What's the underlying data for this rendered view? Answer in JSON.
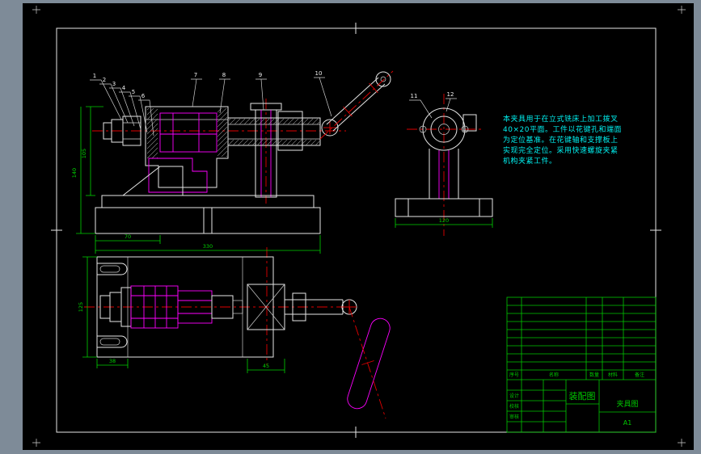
{
  "window": {
    "outer_bg": "#7e8b98",
    "canvas_bg": "#000000"
  },
  "palette": {
    "outline": "#e6e6e6",
    "dimension": "#00d200",
    "centerline": "#e00000",
    "phantom": "#ff00ff",
    "note": "#00f0f0",
    "titleblock": "#00c800"
  },
  "note": {
    "lines": [
      "本夹具用于在立式铣床上加工拨叉",
      "40×20平面。工件以花键孔和端面",
      "为定位基准。在花键轴和支撑板上",
      "实现完全定位。采用快速螺旋夹紧",
      "机构夹紧工件。"
    ]
  },
  "balloons": [
    {
      "label": "1"
    },
    {
      "label": "2"
    },
    {
      "label": "3"
    },
    {
      "label": "4"
    },
    {
      "label": "5"
    },
    {
      "label": "6"
    },
    {
      "label": "7"
    },
    {
      "label": "8"
    },
    {
      "label": "9"
    },
    {
      "label": "10"
    },
    {
      "label": "11"
    },
    {
      "label": "12"
    }
  ],
  "dimensions": {
    "front_height_upper": "105",
    "front_height_total": "140",
    "front_base_sub": "70",
    "front_base_width": "330",
    "side_base_width": "120",
    "top_plate_depth": "125",
    "top_slot": "38",
    "top_block": "45"
  },
  "title_block": {
    "drawing_title": "装配图",
    "drawing_name": "夹具图",
    "sheet_size": "A1",
    "parts_header": [
      "序号",
      "名称",
      "数量",
      "材料",
      "备注"
    ],
    "sig_labels": [
      "设计",
      "校核",
      "审核"
    ]
  }
}
